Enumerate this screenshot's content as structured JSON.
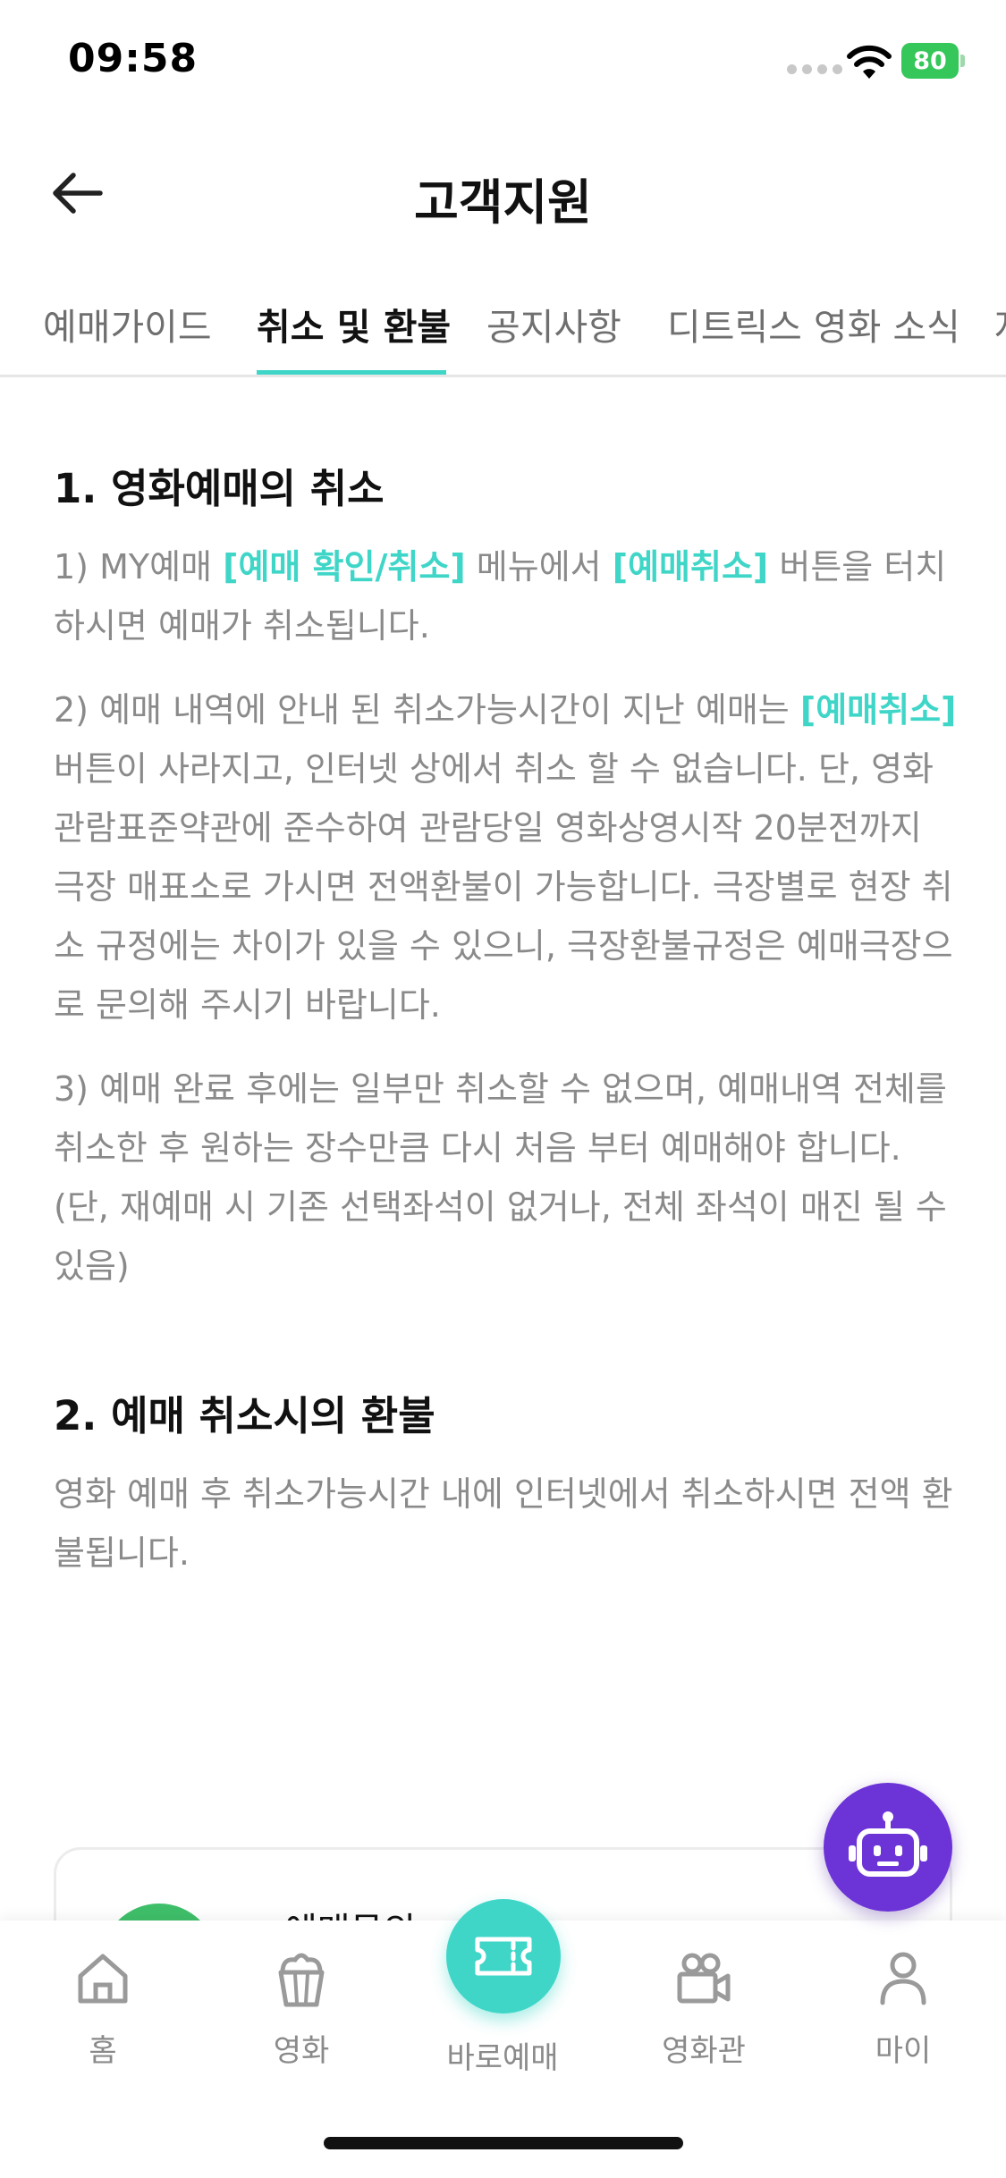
{
  "status_bar": {
    "time": "09:58",
    "battery": "80"
  },
  "header": {
    "title": "고객지원"
  },
  "tabs": [
    {
      "label": "예매가이드"
    },
    {
      "label": "취소 및 환불"
    },
    {
      "label": "공지사항"
    },
    {
      "label": "디트릭스 영화 소식"
    },
    {
      "label": "자"
    }
  ],
  "active_tab": "취소 및 환불",
  "sections": [
    {
      "title": "1. 영화예매의 취소",
      "paragraphs": [
        {
          "pre": "1) MY예매 ",
          "hl1": "[예매 확인/취소]",
          "mid": " 메뉴에서 ",
          "hl2": "[예매취소]",
          "post": " 버튼을 터치하시면 예매가 취소됩니다."
        },
        {
          "pre": "2) 예매 내역에 안내 된 취소가능시간이 지난 예매는 ",
          "hl1": "[예매취소]",
          "post": "버튼이 사라지고, 인터넷 상에서 취소 할 수 없습니다. 단, 영화관람표준약관에 준수하여 관람당일 영화상영시작 20분전까지 극장 매표소로 가시면 전액환불이 가능합니다. 극장별로 현장 취소 규정에는 차이가 있을 수 있으니, 극장환불규정은 예매극장으로 문의해 주시기 바랍니다."
        },
        {
          "text": "3) 예매 완료 후에는 일부만 취소할 수 없으며, 예매내역 전체를 취소한 후 원하는 장수만큼 다시 처음 부터 예매해야 합니다. (단, 재예매 시 기존 선택좌석이 없거나, 전체 좌석이 매진 될 수 있음)"
        }
      ]
    },
    {
      "title": "2. 예매 취소시의 환불",
      "paragraphs": [
        {
          "text": "영화 예매 후 취소가능시간 내에 인터넷에서 취소하시면 전액 환불됩니다."
        }
      ]
    }
  ],
  "faq_card": {
    "title": "예매문의"
  },
  "bottom_nav": {
    "home": "홈",
    "movies": "영화",
    "quick_booking": "바로예매",
    "theaters": "영화관",
    "my": "마이"
  },
  "colors": {
    "accent": "#3fd6c8",
    "chatbot": "#6c33d6",
    "battery": "#35c759",
    "muted_text": "#8a8a8a"
  },
  "icons": {
    "back": "arrow-left-icon",
    "chatbot": "robot-icon",
    "home": "home-icon",
    "movies": "popcorn-icon",
    "quick_booking": "ticket-icon",
    "theaters": "video-camera-icon",
    "my": "person-icon"
  }
}
